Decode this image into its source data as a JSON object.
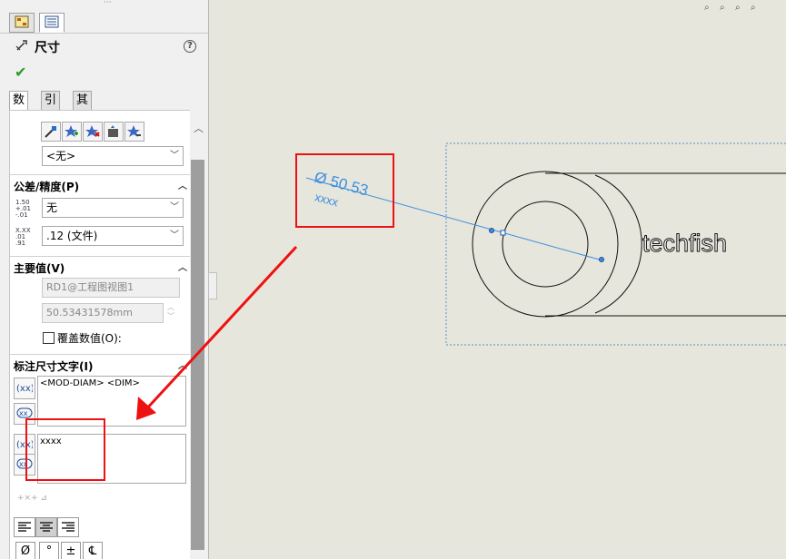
{
  "panel": {
    "title": "尺寸",
    "help": "?",
    "confirm": "✔",
    "subtabs": [
      "数值",
      "引线",
      "其它"
    ],
    "dim_style_select": "<无>",
    "tolerance": {
      "header": "公差/精度(P)",
      "tol_type": "无",
      "precision": ".12 (文件)",
      "tol_icon_text": "1.50 +.01 -.01",
      "prec_icon_text": "X.XX .01 .91"
    },
    "primary_value": {
      "header": "主要值(V)",
      "name": "RD1@工程图视图1",
      "value": "50.53431578mm",
      "override_label": "覆盖数值(O):"
    },
    "dim_text": {
      "header": "标注尺寸文字(I)",
      "main_text": "<MOD-DIAM> <DIM>",
      "below_text": "xxxx"
    },
    "symbols": [
      "Ø",
      "°",
      "±",
      "℄"
    ]
  },
  "drawing": {
    "dimension_text": "Ø 50.53",
    "dimension_sub": "xxxx",
    "label": "techfish"
  },
  "colors": {
    "dimension_blue": "#3c8ee0",
    "annotation_red": "#ee1111",
    "canvas_bg": "#e6e6dc"
  }
}
